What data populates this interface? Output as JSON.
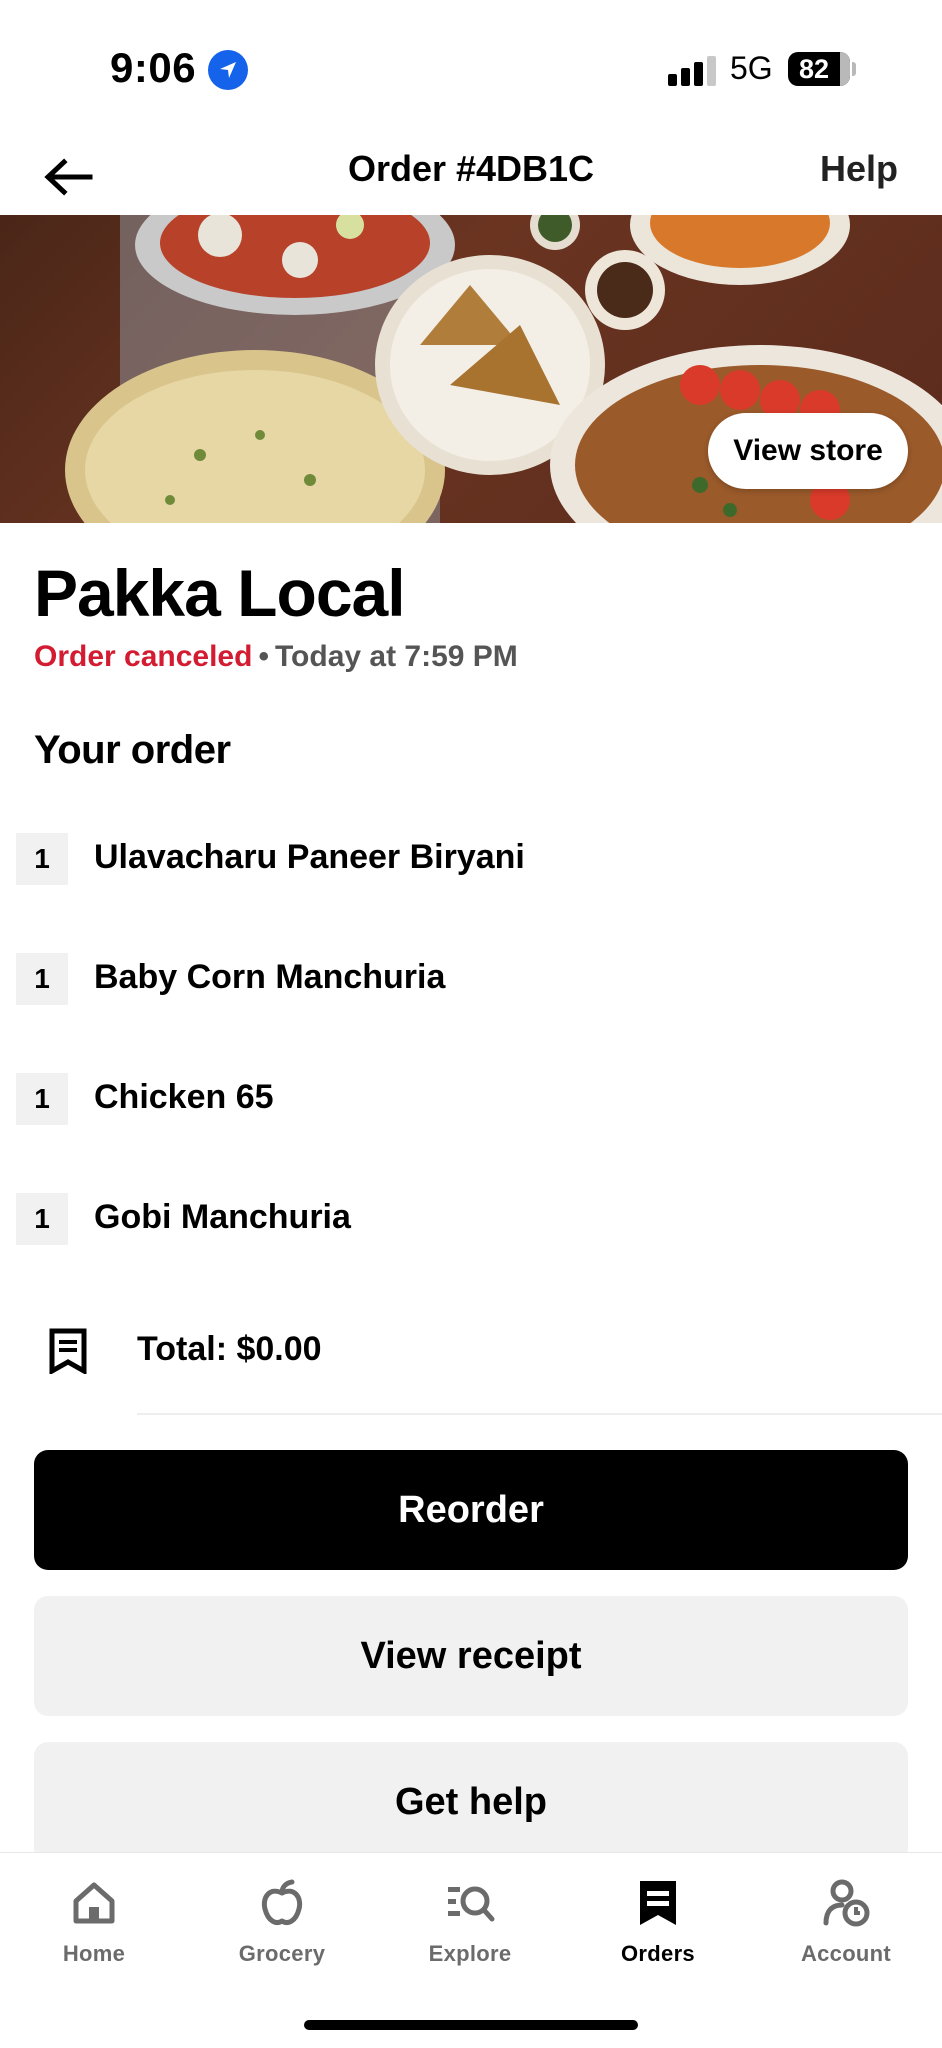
{
  "status_bar": {
    "time": "9:06",
    "network": "5G",
    "battery": "82"
  },
  "header": {
    "title": "Order #4DB1C",
    "help_label": "Help"
  },
  "hero": {
    "view_store_label": "View store"
  },
  "store": {
    "name": "Pakka Local",
    "status": "Order canceled",
    "separator": "•",
    "time": "Today at 7:59 PM"
  },
  "order": {
    "section_title": "Your order",
    "items": [
      {
        "qty": "1",
        "name": "Ulavacharu Paneer Biryani"
      },
      {
        "qty": "1",
        "name": "Baby Corn Manchuria"
      },
      {
        "qty": "1",
        "name": "Chicken 65"
      },
      {
        "qty": "1",
        "name": "Gobi Manchuria"
      }
    ],
    "total": "Total: $0.00"
  },
  "actions": {
    "reorder": "Reorder",
    "view_receipt": "View receipt",
    "get_help": "Get help"
  },
  "tabs": [
    {
      "label": "Home",
      "icon": "home-icon",
      "active": false
    },
    {
      "label": "Grocery",
      "icon": "apple-icon",
      "active": false
    },
    {
      "label": "Explore",
      "icon": "explore-icon",
      "active": false
    },
    {
      "label": "Orders",
      "icon": "receipt-icon",
      "active": true
    },
    {
      "label": "Account",
      "icon": "account-icon",
      "active": false
    }
  ],
  "colors": {
    "canceled": "#d31c32",
    "primary_button": "#000000",
    "secondary_button": "#f1f1f1"
  }
}
